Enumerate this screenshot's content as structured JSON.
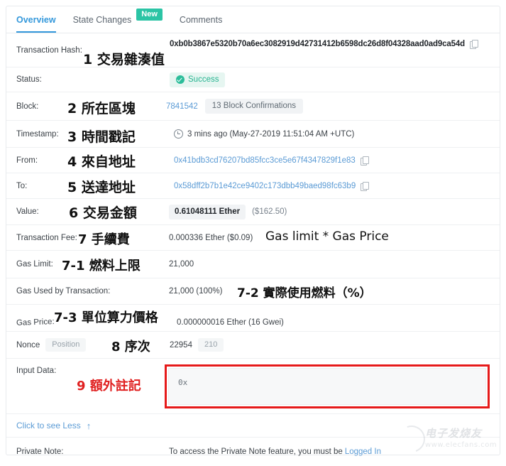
{
  "tabs": [
    {
      "label": "Overview",
      "active": true
    },
    {
      "label": "State Changes",
      "active": false,
      "badge": "New"
    },
    {
      "label": "Comments",
      "active": false
    }
  ],
  "rows": {
    "tx_hash": {
      "label": "Transaction Hash:",
      "value": "0xb0b3867e5320b70a6ec3082919d42731412b6598dc26d8f04328aad0ad9ca54d",
      "annotation": "1 交易雜湊值"
    },
    "status": {
      "label": "Status:",
      "value": "Success"
    },
    "block": {
      "label": "Block:",
      "value": "7841542",
      "confirmations": "13 Block Confirmations",
      "annotation": "2 所在區塊"
    },
    "timestamp": {
      "label": "Timestamp:",
      "value": "3 mins ago (May-27-2019 11:51:04 AM +UTC)",
      "annotation": "3 時間戳記"
    },
    "from": {
      "label": "From:",
      "value": "0x41bdb3cd76207bd85fcc3ce5e67f4347829f1e83",
      "annotation": "4 來自地址"
    },
    "to": {
      "label": "To:",
      "value": "0x58dff2b7b1e42ce9402c173dbb49baed98fc63b9",
      "annotation": "5 送達地址"
    },
    "value": {
      "label": "Value:",
      "value": "0.61048111 Ether",
      "fiat": "($162.50)",
      "annotation": "6 交易金額"
    },
    "tx_fee": {
      "label": "Transaction Fee:",
      "value": "0.000336 Ether ($0.09)",
      "annotation": "7 手續費",
      "note": "Gas limit * Gas Price"
    },
    "gas_limit": {
      "label": "Gas Limit:",
      "value": "21,000",
      "annotation": "7-1 燃料上限"
    },
    "gas_used": {
      "label": "Gas Used by Transaction:",
      "value": "21,000 (100%)",
      "annotation": "7-2 實際使用燃料（%）"
    },
    "gas_price": {
      "label": "Gas Price:",
      "value": "0.000000016 Ether (16 Gwei)",
      "annotation": "7-3 單位算力價格"
    },
    "nonce": {
      "label": "Nonce",
      "position_label": "Position",
      "nonce_value": "22954",
      "position_value": "210",
      "annotation": "8 序次"
    },
    "input_data": {
      "label": "Input Data:",
      "value": "0x",
      "annotation": "9 額外註記"
    },
    "see_less": {
      "label": "Click to see Less",
      "arrow": "↑"
    },
    "private_note": {
      "label": "Private Note:",
      "text_before": "To access the Private Note feature, you must be ",
      "link": "Logged In"
    }
  },
  "watermark": {
    "text": "电子发烧友",
    "url": "www.elecfans.com"
  },
  "colors": {
    "accent_blue": "#3498db",
    "link_blue": "#5b9bd5",
    "success_green": "#28b491",
    "badge_teal": "#2bc4a5",
    "annotation_red": "#e02020"
  }
}
